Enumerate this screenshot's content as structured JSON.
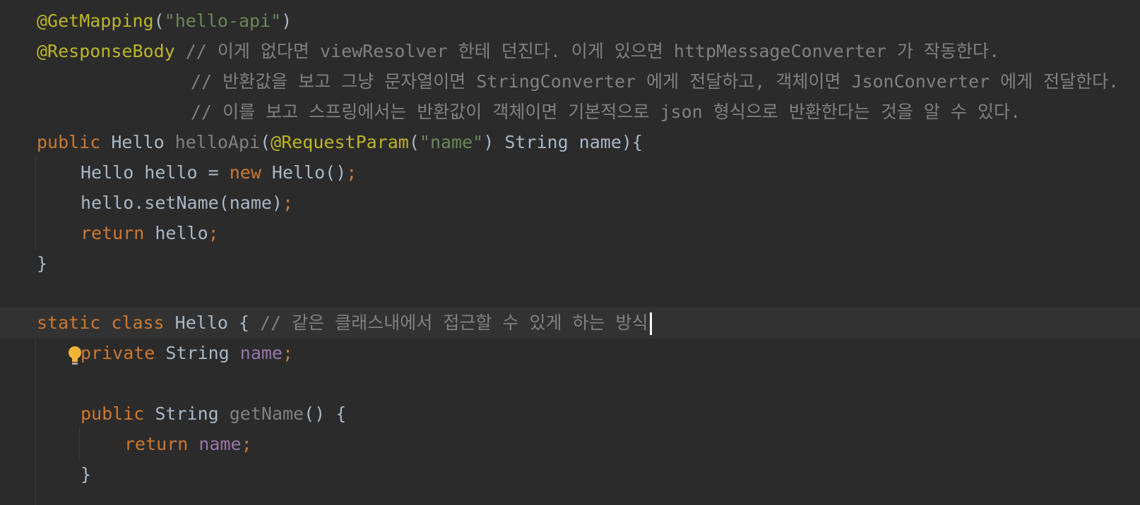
{
  "editor": {
    "lines": {
      "l1": {
        "annotation": "@GetMapping",
        "open_paren": "(",
        "string": "\"hello-api\"",
        "close_paren": ")"
      },
      "l2": {
        "annotation": "@ResponseBody",
        "comment": " // 이게 없다면 viewResolver 한테 던진다. 이게 있으면 httpMessageConverter 가 작동한다."
      },
      "l3": {
        "comment": "// 반환값을 보고 그냥 문자열이면 StringConverter 에게 전달하고, 객체이면 JsonConverter 에게 전달한다."
      },
      "l4": {
        "comment": "// 이를 보고 스프링에서는 반환값이 객체이면 기본적으로 json 형식으로 반환한다는 것을 알 수 있다."
      },
      "l5": {
        "kw_public": "public",
        "type": " Hello ",
        "method": "helloApi",
        "open_paren": "(",
        "annotation": "@RequestParam",
        "ann_open": "(",
        "string": "\"name\"",
        "ann_close": ")",
        "rest": " String name){"
      },
      "l6": {
        "decl": "Hello hello = ",
        "kw_new": "new",
        "ctor": " Hello()",
        "semi": ";"
      },
      "l7": {
        "call": "hello.setName(name)",
        "semi": ";"
      },
      "l8": {
        "kw_return": "return",
        "value": " hello",
        "semi": ";"
      },
      "l9": {
        "brace": "}"
      },
      "l11": {
        "kw_static": "static",
        "kw_class": " class",
        "name": " Hello { ",
        "comment": "// 같은 클래스내에서 접근할 수 있게 하는 방식"
      },
      "l12": {
        "kw_private": "private",
        "type": " String ",
        "field": "name",
        "semi": ";"
      },
      "l14": {
        "kw_public": "public",
        "type": " String ",
        "method": "getName",
        "rest": "() {"
      },
      "l15": {
        "kw_return": "return",
        "space": " ",
        "field": "name",
        "semi": ";"
      },
      "l16": {
        "brace": "}"
      }
    },
    "gutter": {
      "bulb_icon": "lightbulb-icon",
      "bulb_color": "#f2b437"
    },
    "colors": {
      "background": "#2b2b2b",
      "current_line": "#323232",
      "annotation": "#bbb529",
      "string": "#6a8759",
      "comment": "#808080",
      "keyword": "#cc7832",
      "plain": "#a9b7c6",
      "field": "#9876aa"
    }
  }
}
